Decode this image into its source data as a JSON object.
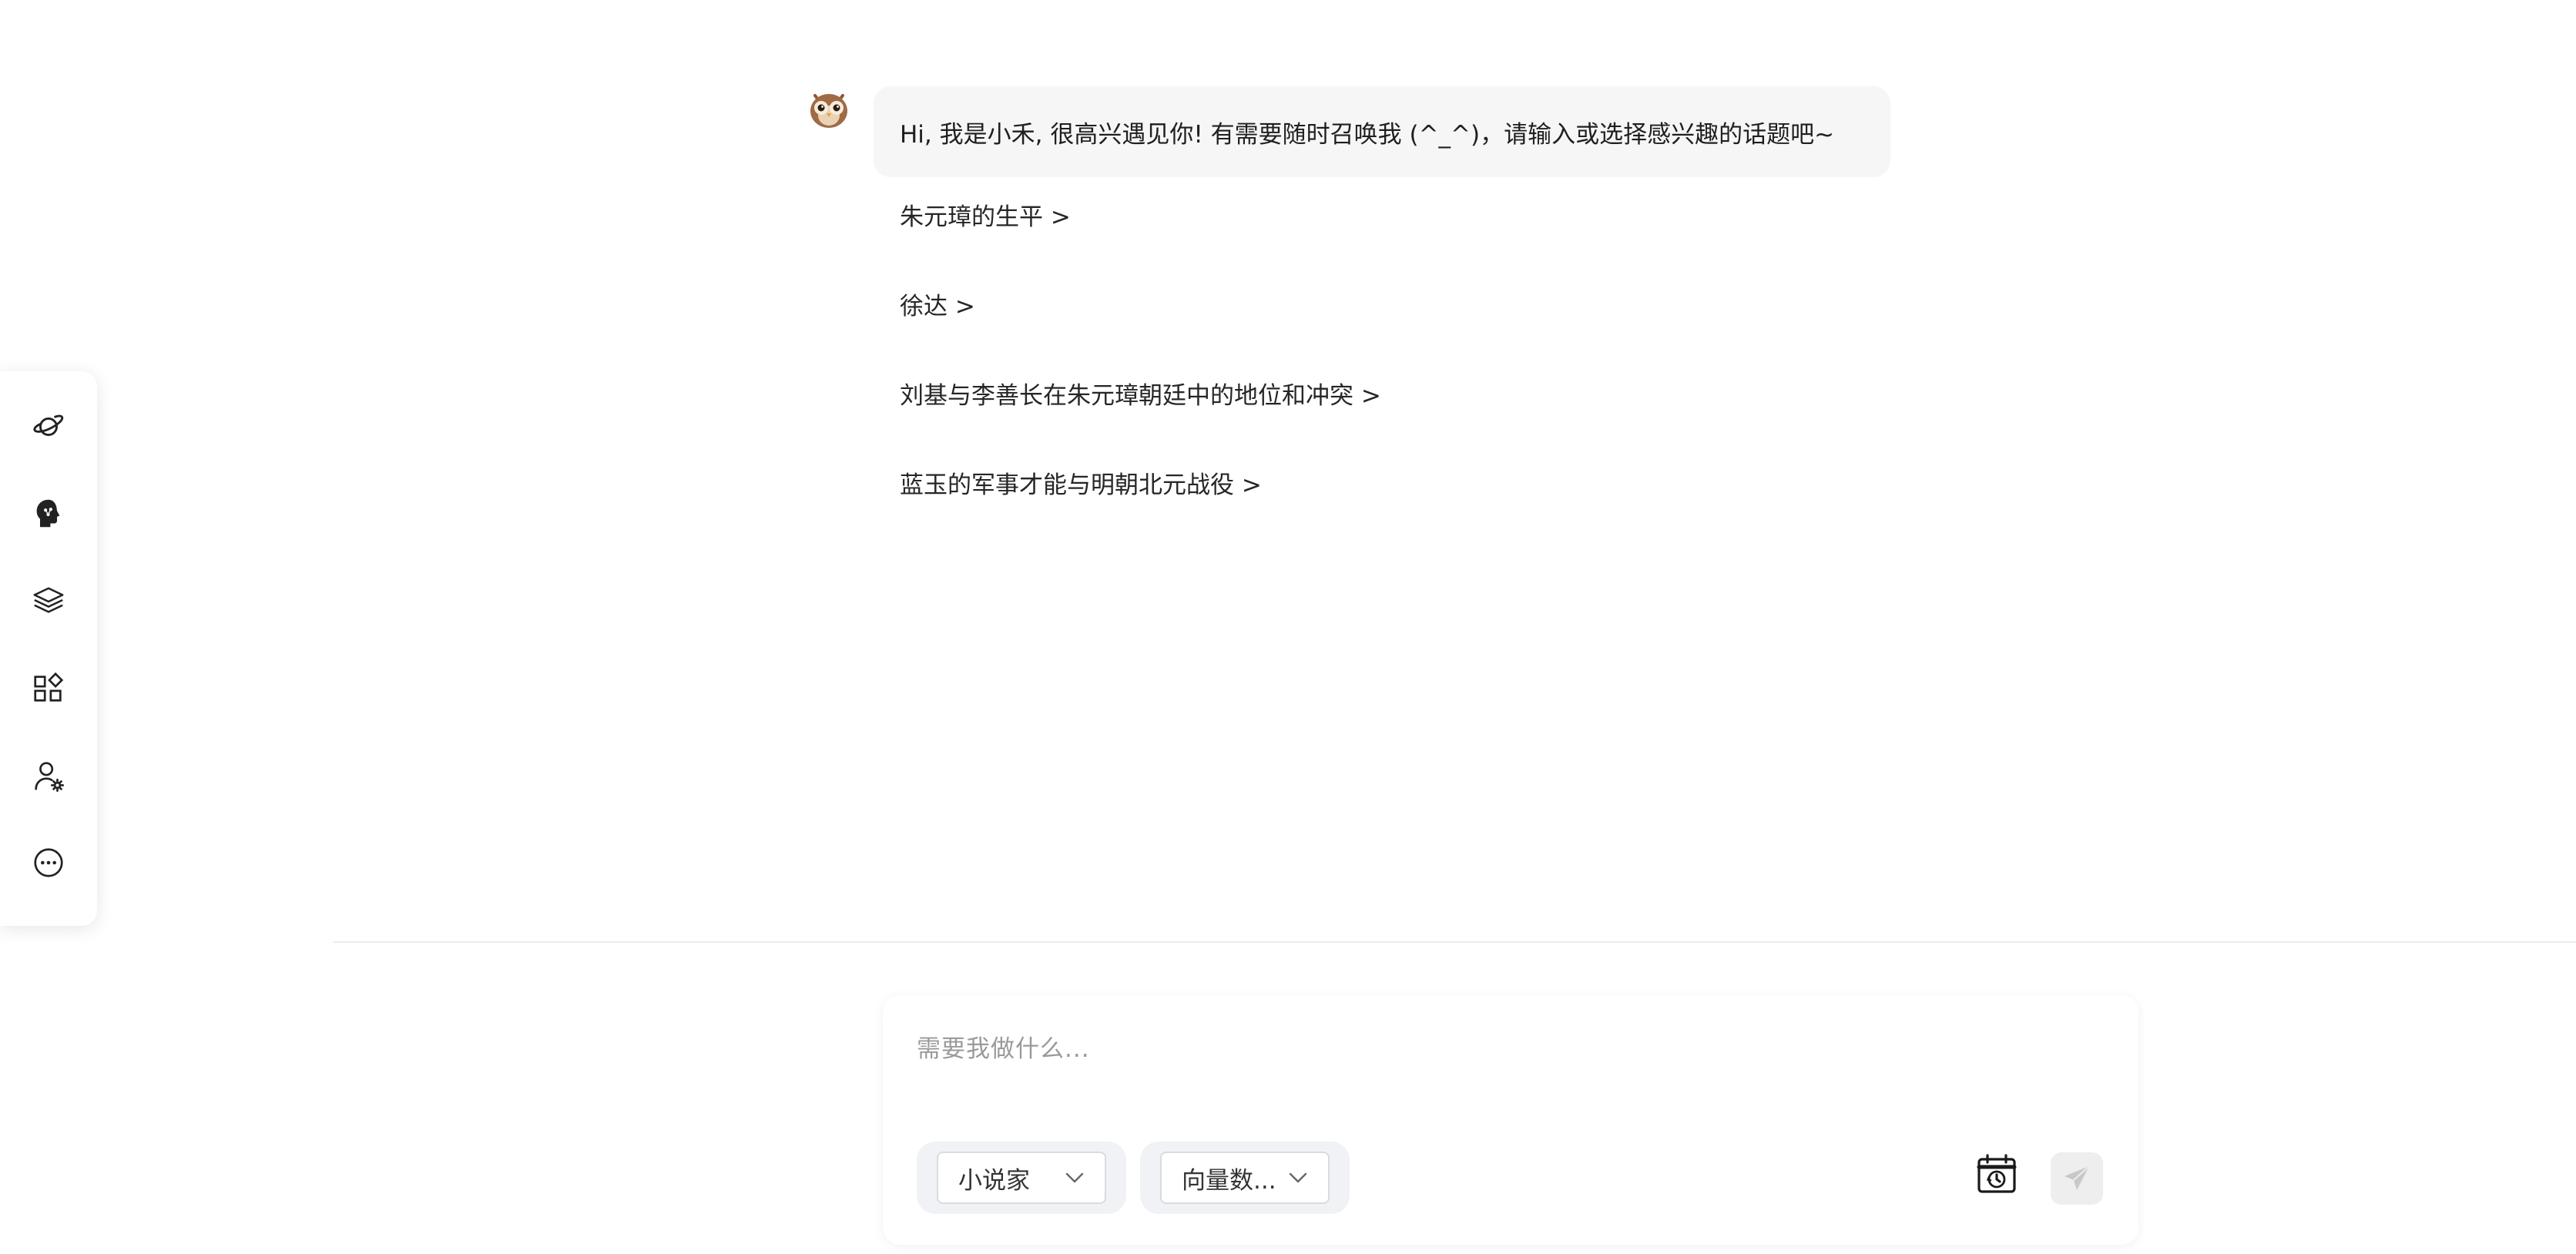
{
  "toolbar": {
    "items": [
      {
        "icon": "planet-icon"
      },
      {
        "icon": "brain-head-icon"
      },
      {
        "icon": "layers-icon"
      },
      {
        "icon": "apps-grid-icon"
      },
      {
        "icon": "user-settings-icon"
      },
      {
        "icon": "more-icon"
      }
    ]
  },
  "chat": {
    "avatar_icon": "owl-avatar-icon",
    "greeting": "Hi, 我是小禾, 很高兴遇见你! 有需要随时召唤我 (^_^)，请输入或选择感兴趣的话题吧~",
    "suggestions": [
      "朱元璋的生平 >",
      "徐达 >",
      "刘基与李善长在朱元璋朝廷中的地位和冲突 >",
      "蓝玉的军事才能与明朝北元战役 >"
    ]
  },
  "input": {
    "placeholder": "需要我做什么...",
    "value": "",
    "role_select": {
      "selected": "小说家"
    },
    "kb_select": {
      "selected": "向量数..."
    },
    "history_icon": "calendar-history-icon",
    "send_icon": "send-icon"
  },
  "colors": {
    "bubble_bg": "#f6f6f7",
    "pill_bg": "#f1f2f6",
    "send_bg": "#eeeeee",
    "divider": "#ececec"
  }
}
